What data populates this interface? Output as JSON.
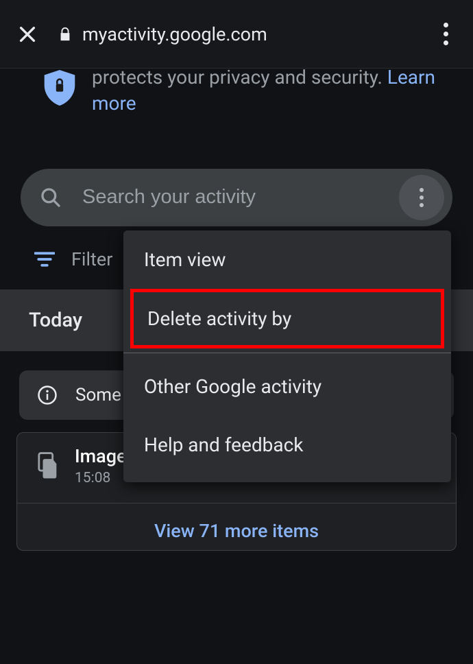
{
  "topbar": {
    "url": "myactivity.google.com"
  },
  "banner": {
    "text_partial": "protects your privacy and security. ",
    "link": "Learn more"
  },
  "search": {
    "placeholder": "Search your activity"
  },
  "filter": {
    "label": "Filter"
  },
  "section": {
    "today": "Today"
  },
  "info_chip": {
    "text": "Some"
  },
  "card": {
    "title": "Image Search, Maps and more",
    "time": "15:08",
    "footer": "View 71 more items"
  },
  "popup": {
    "item_view": "Item view",
    "delete_activity": "Delete activity by",
    "other_activity": "Other Google activity",
    "help_feedback": "Help and feedback"
  }
}
